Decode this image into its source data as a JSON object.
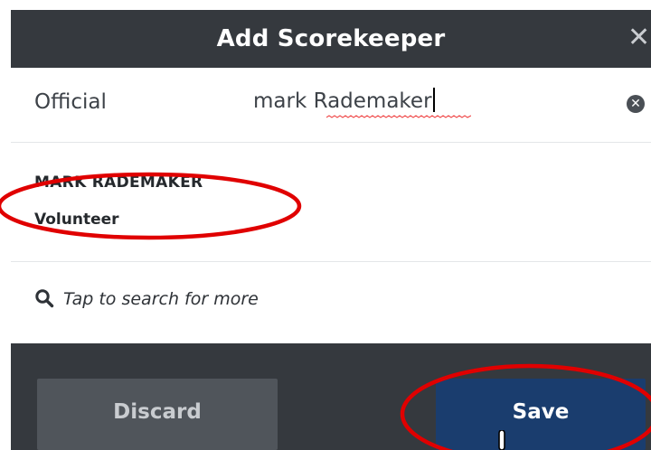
{
  "dialog": {
    "title": "Add Scorekeeper",
    "close_glyph": "✕"
  },
  "official": {
    "label": "Official",
    "value_part1": "mark ",
    "value_part2": "Rademaker",
    "clear_glyph": "✕"
  },
  "results": [
    {
      "name": "MARK RADEMAKER",
      "role": "Volunteer"
    }
  ],
  "search_more": {
    "text": "Tap to search for more",
    "icon": "search-icon"
  },
  "footer": {
    "discard_label": "Discard",
    "save_label": "Save"
  },
  "colors": {
    "header_bg": "#35393e",
    "save_bg": "#1a3d6e",
    "discard_bg": "#50555b",
    "annotation": "#e00000"
  }
}
